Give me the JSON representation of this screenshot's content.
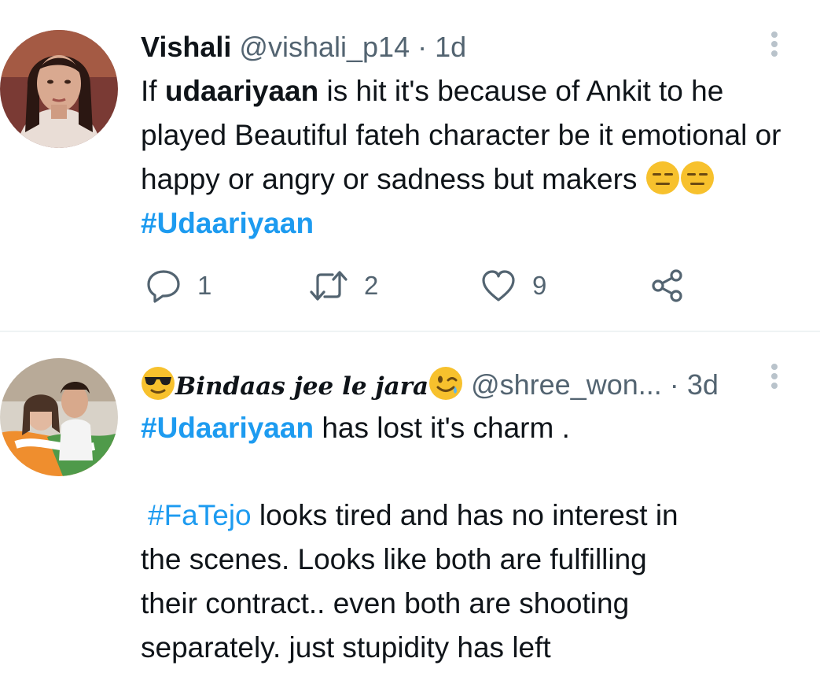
{
  "tweets": [
    {
      "display_name": "Vishali",
      "handle": "@vishali_p14",
      "separator": "·",
      "time": "1d",
      "text": {
        "prefix": "If ",
        "mention_bold": "udaariyaan",
        "middle": " is hit it's because of Ankit to he played Beautiful fateh character be it emotional or happy or angry or sadness but makers ",
        "emojis": [
          "expressionless-face",
          "expressionless-face"
        ],
        "hashtag": "#Udaariyaan"
      },
      "stats": {
        "replies": "1",
        "retweets": "2",
        "likes": "9"
      }
    },
    {
      "display_name": "Bindaas jee le jara",
      "name_emojis": [
        "sunglasses-face",
        "winking-face"
      ],
      "handle": "@shree_won...",
      "separator": "·",
      "time": "3d",
      "lines": {
        "hashtag1": "#Udaariyaan",
        "line1_rest": " has lost it's charm .",
        "hashtag2": "#FaTejo",
        "line2_rest": " looks tired and has no interest in",
        "line3": "the scenes. Looks like both are fulfilling",
        "line4": "their contract.. even both are shooting",
        "line5": "separately. just stupidity has left"
      }
    }
  ],
  "colors": {
    "text": "#0f1419",
    "secondary": "#536471",
    "link": "#1d9bf0",
    "divider": "#eff3f4"
  }
}
